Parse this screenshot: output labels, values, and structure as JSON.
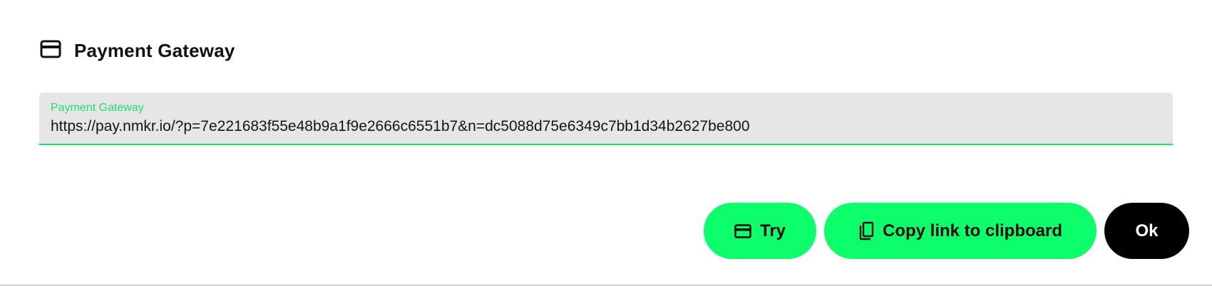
{
  "header": {
    "icon": "credit-card-icon",
    "title": "Payment Gateway"
  },
  "field": {
    "label": "Payment Gateway",
    "value": "https://pay.nmkr.io/?p=7e221683f55e48b9a1f9e2666c6551b7&n=dc5088d75e6349c7bb1d34b2627be800"
  },
  "actions": {
    "try": {
      "label": "Try",
      "icon": "credit-card-icon"
    },
    "copy": {
      "label": "Copy link to clipboard",
      "icon": "copy-icon"
    },
    "ok": {
      "label": "Ok"
    }
  },
  "colors": {
    "accent": "#0cff6b",
    "field_bg": "#e6e6e6",
    "label_green": "#1ee06f",
    "ok_bg": "#000000"
  }
}
